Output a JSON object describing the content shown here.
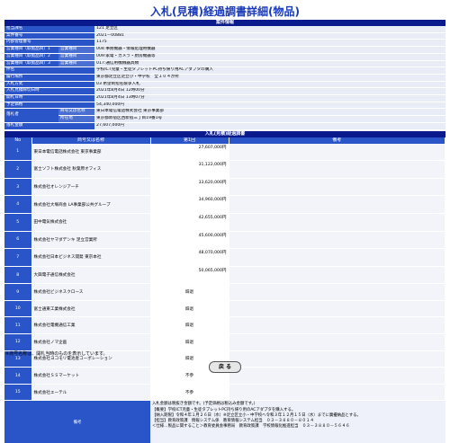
{
  "page": {
    "title": "入札(見積)経過調書詳細(物品)",
    "info_header": "案件情報",
    "progress_header": "入札(見積)経過調書",
    "note": "※商号名称は、開札当時のものを表示しています。",
    "back_label": "戻 る"
  },
  "info": [
    {
      "label": "担当課名",
      "value": "121 足立区"
    },
    {
      "label": "案件番号",
      "value": "2021－00881"
    },
    {
      "label": "内部管理番号",
      "value": "1175"
    },
    {
      "label": "営業種目（取扱品目）1",
      "label2": "営業種目",
      "value": "004:事務機器・情報処理用機器"
    },
    {
      "label": "営業種目（取扱品目）2",
      "label2": "営業種目",
      "value": "009:家電・カメラ・厨房機器等"
    },
    {
      "label": "営業種目（取扱品目）3",
      "label2": "営業種目",
      "value": "017:通信用機械器具類"
    },
    {
      "label": "件名",
      "value": "学校ICT児童・生徒タブレットPC持ち帰り用ACアダプタの購入"
    },
    {
      "label": "履行場所",
      "value": "東京都足立区足立小・中学校　全１０４か所"
    },
    {
      "label": "入札方式",
      "value": "03 希望制指名競争入札"
    },
    {
      "label": "入札見積締切日時",
      "value": "2021年8月4日 12時00分"
    },
    {
      "label": "開札日時",
      "value": "2021年8月4日 13時07分"
    },
    {
      "label": "予定価格",
      "value": "54,340,000円"
    },
    {
      "label": "落札者",
      "sub": [
        {
          "label2": "商号又は名称",
          "value": "東日本電信電話株式会社 東京事業部"
        },
        {
          "label2": "所在地",
          "value": "東京都新宿区西新宿三丁目19番1号"
        }
      ]
    },
    {
      "label": "落札金額",
      "value": "27,607,000円"
    }
  ],
  "table_headers": {
    "no": "No",
    "name": "商号又は名称",
    "amount": "第1回",
    "remarks": "備考"
  },
  "bidders": [
    {
      "no": "1",
      "name": "東日本電信電話株式会社 東京事業部",
      "amount": "27,607,000円",
      "remark": ""
    },
    {
      "no": "2",
      "name": "富士ソフト株式会社 秋葉原オフィス",
      "amount": "31,122,000円",
      "remark": ""
    },
    {
      "no": "3",
      "name": "株式会社オレンジアーチ",
      "amount": "33,620,000円",
      "remark": ""
    },
    {
      "no": "4",
      "name": "株式会社大塚商会 LA事業部公共グループ",
      "amount": "34,960,000円",
      "remark": ""
    },
    {
      "no": "5",
      "name": "田中電気株式会社",
      "amount": "42,655,000円",
      "remark": ""
    },
    {
      "no": "6",
      "name": "株式会社ヤマダデンキ 足立営業所",
      "amount": "45,600,000円",
      "remark": ""
    },
    {
      "no": "7",
      "name": "株式会社日本ビジネス開発 東京本社",
      "amount": "48,070,000円",
      "remark": ""
    },
    {
      "no": "8",
      "name": "大興電子通信株式会社",
      "amount": "50,065,000円",
      "remark": ""
    },
    {
      "no": "9",
      "name": "株式会社ビジネスクロース",
      "amount": "辞退",
      "remark": ""
    },
    {
      "no": "10",
      "name": "富士通東工業株式会社",
      "amount": "辞退",
      "remark": ""
    },
    {
      "no": "11",
      "name": "株式会社電機通信工業",
      "amount": "辞退",
      "remark": ""
    },
    {
      "no": "12",
      "name": "株式会社ノマ企画",
      "amount": "辞退",
      "remark": ""
    },
    {
      "no": "13",
      "name": "株式会社ヨコモリ電池産コーポレーション",
      "amount": "辞退",
      "remark": ""
    },
    {
      "no": "14",
      "name": "株式会社ＳＳマーケット",
      "amount": "不参",
      "remark": ""
    },
    {
      "no": "15",
      "name": "株式会社エーテル",
      "amount": "不参",
      "remark": ""
    }
  ],
  "remarks": {
    "label": "備考",
    "lines": [
      "入札金額は税抜き金額です。(予定価格は税込み金額です。)",
      "【概要】学校ICT児童・生徒タブレットPC持ち帰り用のACアダプタを購入する。",
      "【納入期限】令和４年１月２６日（水）※足立区立小・中学校へ令和３年１２月１５日（水）までに廣擾納品とする。",
      "【担当】教育政策課　情報システム係　教育情報システム担当　０３－３８８０－８０１４",
      "＜仕様…製品に関すること＞教育委員会事務局　教育政策課　学校情報化推進担当　０３－３８８０－５６４６"
    ]
  }
}
